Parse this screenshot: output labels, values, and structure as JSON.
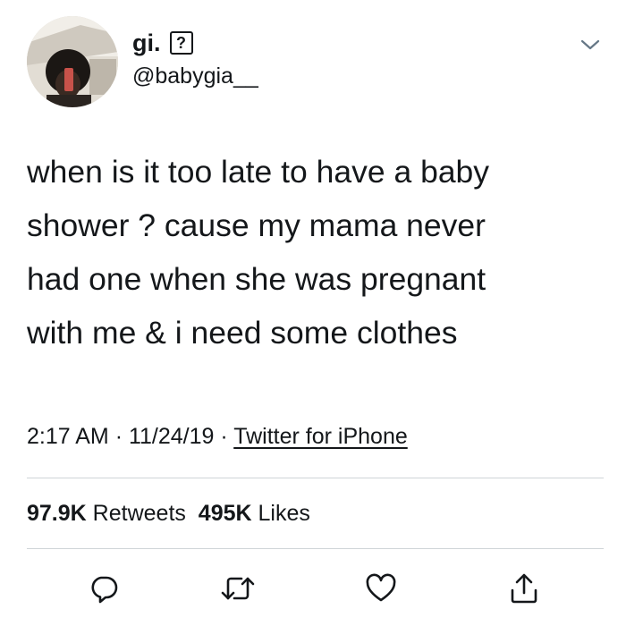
{
  "user": {
    "display_name": "gi.",
    "name_emoji": "?",
    "handle": "@babygia__"
  },
  "tweet": {
    "text": "when is it too late to have a baby\nshower ? cause my mama never\nhad one when she was pregnant\nwith me & i need some clothes",
    "time": "2:17 AM",
    "date": "11/24/19",
    "separator": "·",
    "source": "Twitter for iPhone"
  },
  "stats": {
    "retweets_count": "97.9K",
    "retweets_label": "Retweets",
    "likes_count": "495K",
    "likes_label": "Likes"
  },
  "icons": {
    "more": "chevron-down-icon",
    "reply": "reply-icon",
    "retweet": "retweet-icon",
    "like": "heart-icon",
    "share": "share-icon"
  },
  "colors": {
    "text": "#14171a",
    "divider": "#cfd4d8",
    "background": "#ffffff"
  }
}
